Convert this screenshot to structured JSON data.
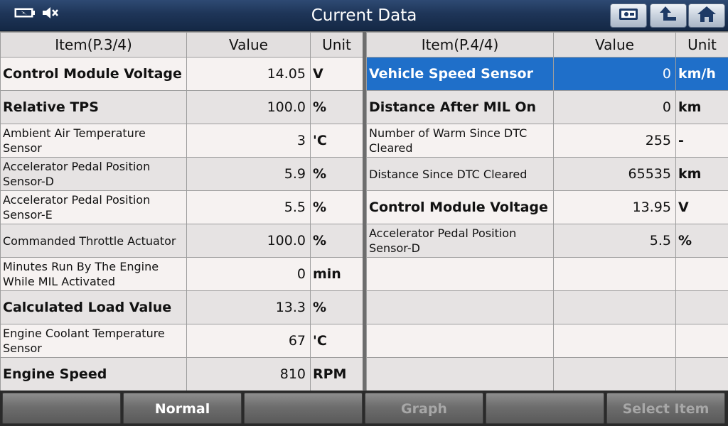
{
  "header": {
    "title": "Current Data",
    "icons": [
      "battery-icon",
      "speaker-mute-icon",
      "record-icon",
      "back-arrow-icon",
      "home-icon"
    ]
  },
  "left_table": {
    "columns": [
      "Item(P.3/4)",
      "Value",
      "Unit"
    ],
    "rows": [
      {
        "item": "Control Module Voltage",
        "value": "14.05",
        "unit": "V",
        "style": "big"
      },
      {
        "item": "Relative TPS",
        "value": "100.0",
        "unit": "%",
        "style": "big"
      },
      {
        "item": "Ambient Air Temperature Sensor",
        "value": "3",
        "unit": "'C",
        "style": "small"
      },
      {
        "item": "Accelerator Pedal Position Sensor-D",
        "value": "5.9",
        "unit": "%",
        "style": "small"
      },
      {
        "item": "Accelerator Pedal Position Sensor-E",
        "value": "5.5",
        "unit": "%",
        "style": "small"
      },
      {
        "item": "Commanded Throttle Actuator",
        "value": "100.0",
        "unit": "%",
        "style": "small"
      },
      {
        "item": "Minutes Run By The Engine While MIL Activated",
        "value": "0",
        "unit": "min",
        "style": "small"
      },
      {
        "item": "Calculated Load Value",
        "value": "13.3",
        "unit": "%",
        "style": "big"
      },
      {
        "item": "Engine Coolant Temperature Sensor",
        "value": "67",
        "unit": "'C",
        "style": "small"
      },
      {
        "item": "Engine Speed",
        "value": "810",
        "unit": "RPM",
        "style": "big"
      }
    ]
  },
  "right_table": {
    "columns": [
      "Item(P.4/4)",
      "Value",
      "Unit"
    ],
    "rows": [
      {
        "item": "Vehicle Speed Sensor",
        "value": "0",
        "unit": "km/h",
        "style": "big",
        "selected": true
      },
      {
        "item": "Distance After MIL On",
        "value": "0",
        "unit": "km",
        "style": "big"
      },
      {
        "item": "Number of Warm Since DTC Cleared",
        "value": "255",
        "unit": "-",
        "style": "small"
      },
      {
        "item": "Distance Since DTC Cleared",
        "value": "65535",
        "unit": "km",
        "style": "small"
      },
      {
        "item": "Control Module Voltage",
        "value": "13.95",
        "unit": "V",
        "style": "big"
      },
      {
        "item": "Accelerator Pedal Position Sensor-D",
        "value": "5.5",
        "unit": "%",
        "style": "small"
      },
      {
        "item": "",
        "value": "",
        "unit": "",
        "style": "small"
      },
      {
        "item": "",
        "value": "",
        "unit": "",
        "style": "small"
      },
      {
        "item": "",
        "value": "",
        "unit": "",
        "style": "small"
      },
      {
        "item": "",
        "value": "",
        "unit": "",
        "style": "small"
      }
    ]
  },
  "bottom_bar": {
    "buttons": [
      {
        "label": "",
        "state": "disabled"
      },
      {
        "label": "Normal",
        "state": "active"
      },
      {
        "label": "",
        "state": "disabled"
      },
      {
        "label": "Graph",
        "state": "disabled"
      },
      {
        "label": "",
        "state": "disabled"
      },
      {
        "label": "Select Item",
        "state": "disabled"
      }
    ]
  },
  "colors": {
    "selected_row": "#1f6fc9",
    "title_bar": "#1e3558"
  }
}
